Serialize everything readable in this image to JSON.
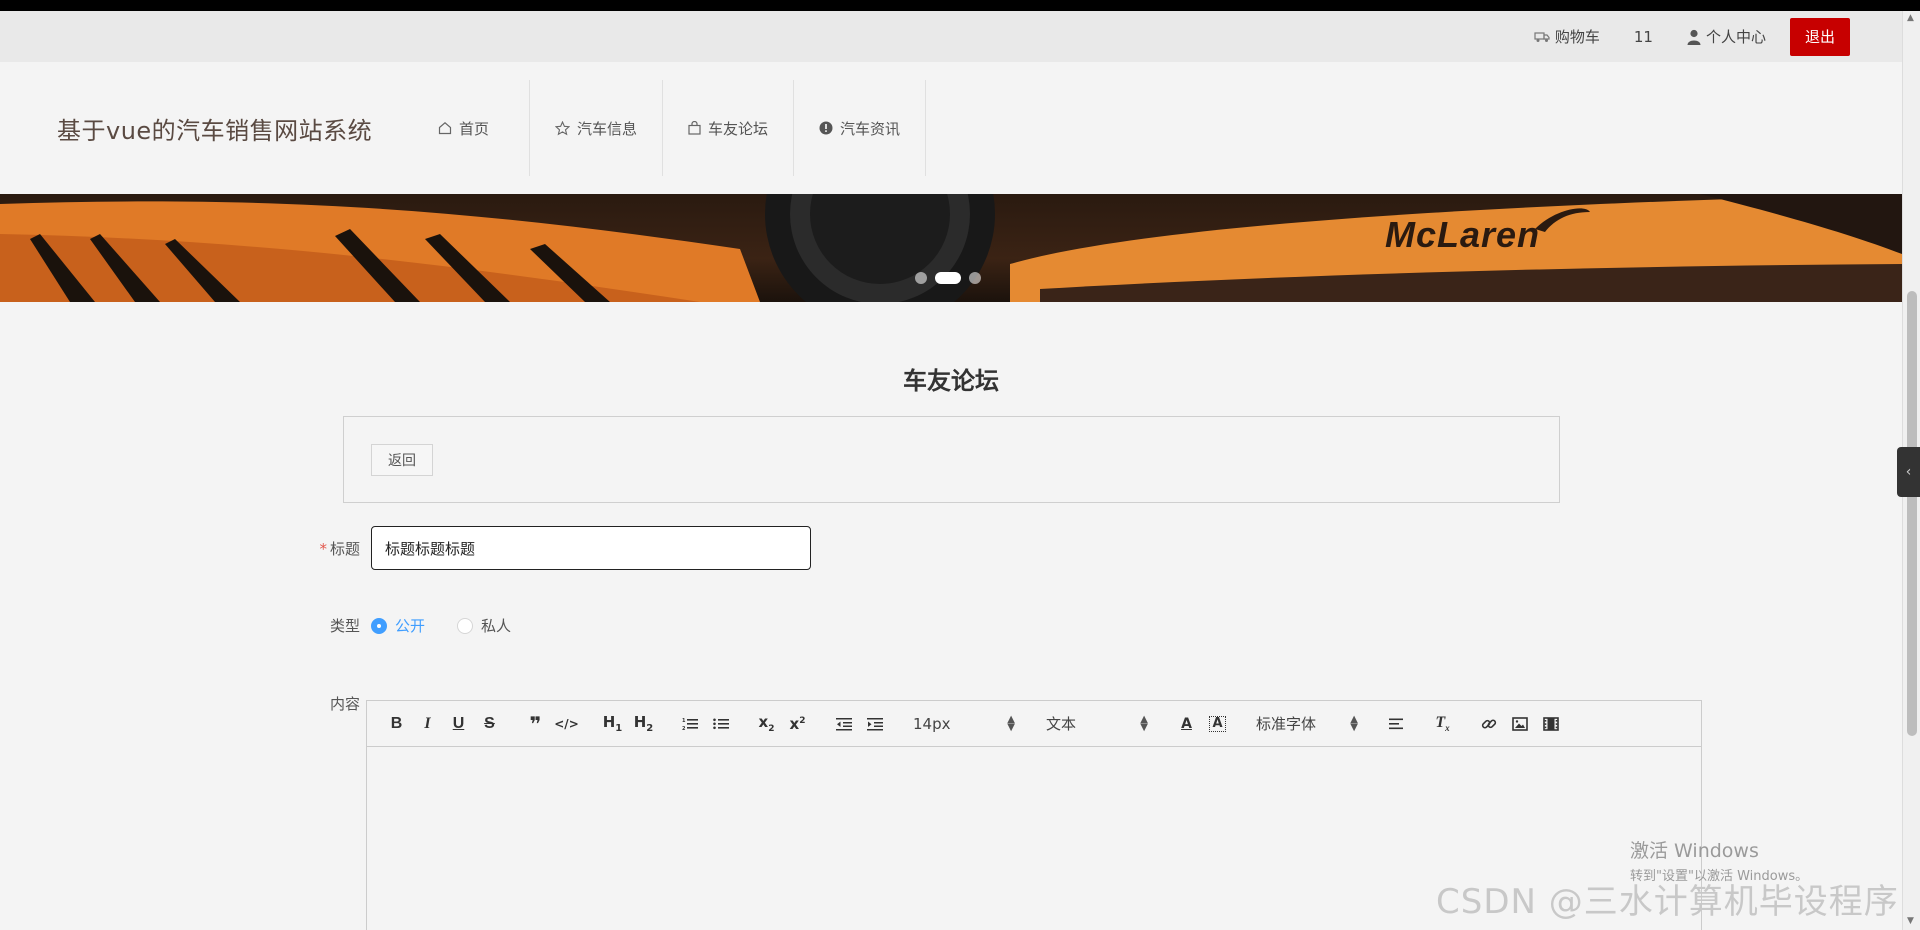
{
  "topbar": {
    "cart_label": "购物车",
    "count": "11",
    "user_center_label": "个人中心",
    "logout_label": "退出"
  },
  "header": {
    "site_title": "基于vue的汽车销售网站系统",
    "nav": [
      {
        "label": "首页",
        "icon": "home-icon"
      },
      {
        "label": "汽车信息",
        "icon": "star-icon"
      },
      {
        "label": "车友论坛",
        "icon": "bag-icon"
      },
      {
        "label": "汽车资讯",
        "icon": "info-icon"
      }
    ]
  },
  "banner": {
    "brand_text": "McLaren",
    "slides": 3,
    "active_slide": 2
  },
  "page": {
    "title": "车友论坛",
    "back_label": "返回"
  },
  "form": {
    "title_label": "标题",
    "title_value": "标题标题标题",
    "type_label": "类型",
    "type_options": [
      "公开",
      "私人"
    ],
    "type_selected": "公开",
    "content_label": "内容"
  },
  "editor": {
    "font_size": "14px",
    "header_format": "文本",
    "font_family": "标准字体"
  },
  "watermarks": {
    "activate_line1": "激活 Windows",
    "activate_line2": "转到\"设置\"以激活 Windows。",
    "csdn": "CSDN @三水计算机毕设程序"
  },
  "colors": {
    "logout_bg": "#c70000",
    "radio_accent": "#409eff",
    "required_star": "#e2574c"
  }
}
